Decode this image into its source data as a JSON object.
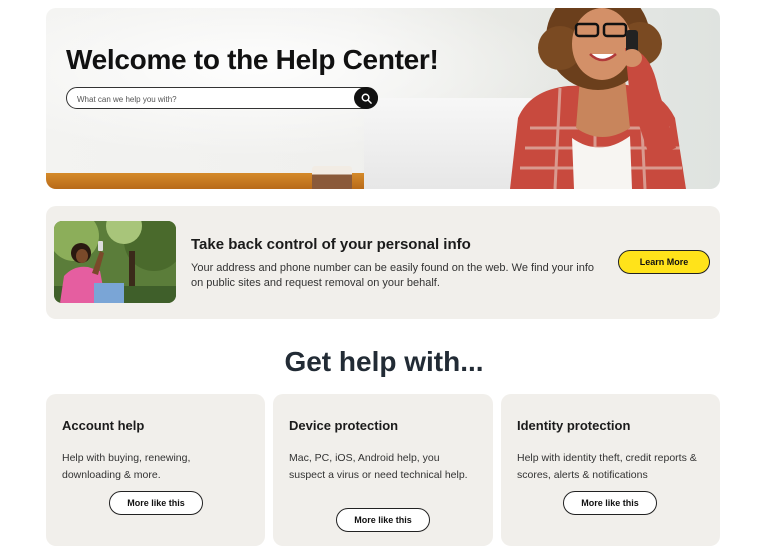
{
  "hero": {
    "title": "Welcome to the Help Center!",
    "search_placeholder": "What can we help you with?"
  },
  "promo": {
    "title": "Take back control of your personal info",
    "text": "Your address and phone number can be easily found on the web. We find your info on public sites and request removal on your behalf.",
    "button_label": "Learn More",
    "button_color": "#ffe31a"
  },
  "section": {
    "title": "Get help with..."
  },
  "cards": [
    {
      "title": "Account help",
      "text": "Help with buying, renewing, downloading & more.",
      "button_label": "More like this"
    },
    {
      "title": "Device protection",
      "text": "Mac, PC, iOS, Android help, you suspect a virus or need technical help.",
      "button_label": "More like this"
    },
    {
      "title": "Identity protection",
      "text": "Help with identity theft, credit reports & scores, alerts & notifications",
      "button_label": "More like this"
    }
  ],
  "colors": {
    "card_background": "#f1efeb",
    "dark_text": "#222b35"
  }
}
